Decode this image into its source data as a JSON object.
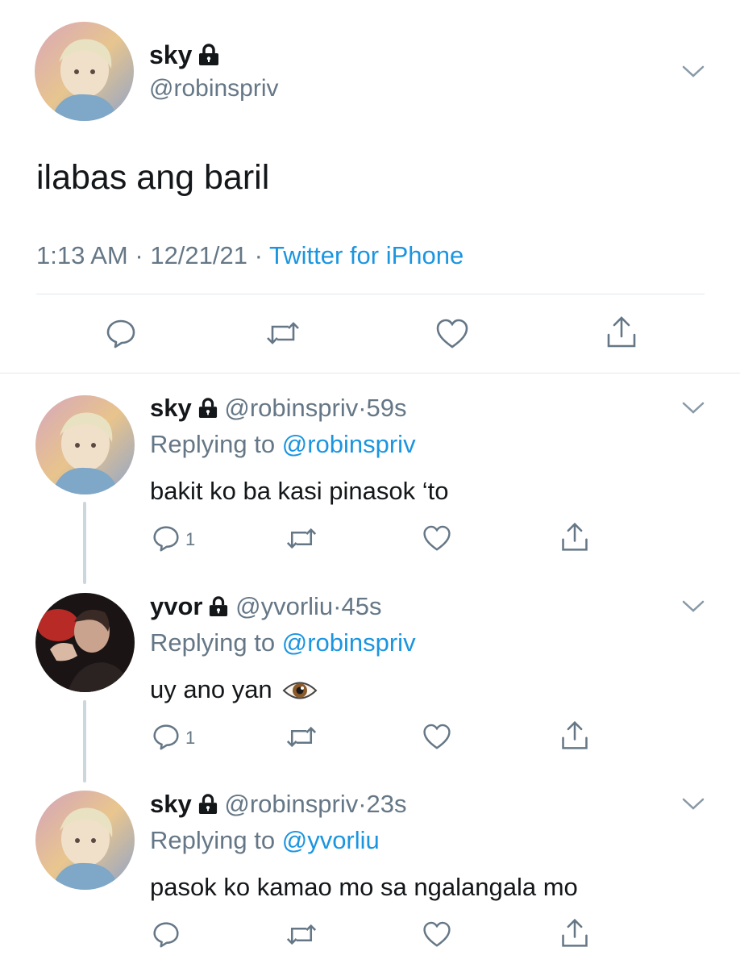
{
  "main_tweet": {
    "display_name": "sky",
    "handle": "@robinspriv",
    "text": "ilabas ang baril",
    "time": "1:13 AM",
    "date": "12/21/21",
    "separator": "·",
    "source": "Twitter for iPhone"
  },
  "replies": [
    {
      "display_name": "sky",
      "handle": "@robinspriv",
      "dot": "·",
      "age": "59s",
      "replying_prefix": "Replying to",
      "replying_to": "@robinspriv",
      "text": "bakit ko ba kasi pinasok ‘to",
      "reply_count": "1"
    },
    {
      "display_name": "yvor",
      "handle": "@yvorliu",
      "dot": "·",
      "age": "45s",
      "replying_prefix": "Replying to",
      "replying_to": "@robinspriv",
      "text": "uy ano yan",
      "emoji": "👁",
      "reply_count": "1"
    },
    {
      "display_name": "sky",
      "handle": "@robinspriv",
      "dot": "·",
      "age": "23s",
      "replying_prefix": "Replying to",
      "replying_to": "@yvorliu",
      "text": "pasok ko kamao mo sa ngalangala mo",
      "reply_count": ""
    }
  ],
  "icons": {
    "lock": "lock-icon",
    "chevron": "chevron-down-icon",
    "reply": "reply-icon",
    "retweet": "retweet-icon",
    "like": "heart-icon",
    "share": "share-icon"
  },
  "colors": {
    "link": "#1b95e0",
    "secondary": "#657786",
    "divider": "#e1e8ed",
    "thread_line": "#ccd6dd"
  }
}
